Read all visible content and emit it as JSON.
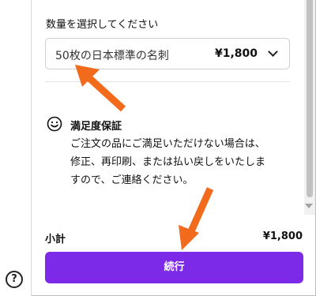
{
  "quantity": {
    "label": "数量を選択してください",
    "selected_option": "50枚の日本標準の名刺",
    "selected_price": "¥1,800"
  },
  "guarantee": {
    "title": "満足度保証",
    "lines": [
      "ご注文の品にご満足いただけない場合は、",
      "修正、再印刷、または払い戻しをいたしま",
      "すので、ご連絡ください。"
    ]
  },
  "subtotal": {
    "label": "小計",
    "value": "¥1,800"
  },
  "continue_button": {
    "label": "続行"
  },
  "help": {
    "label": "?"
  },
  "colors": {
    "primary": "#7d2ae8",
    "annotation_arrow": "#f26b1d"
  },
  "icons": [
    "smile-icon",
    "chevron-down-icon",
    "help-icon"
  ]
}
